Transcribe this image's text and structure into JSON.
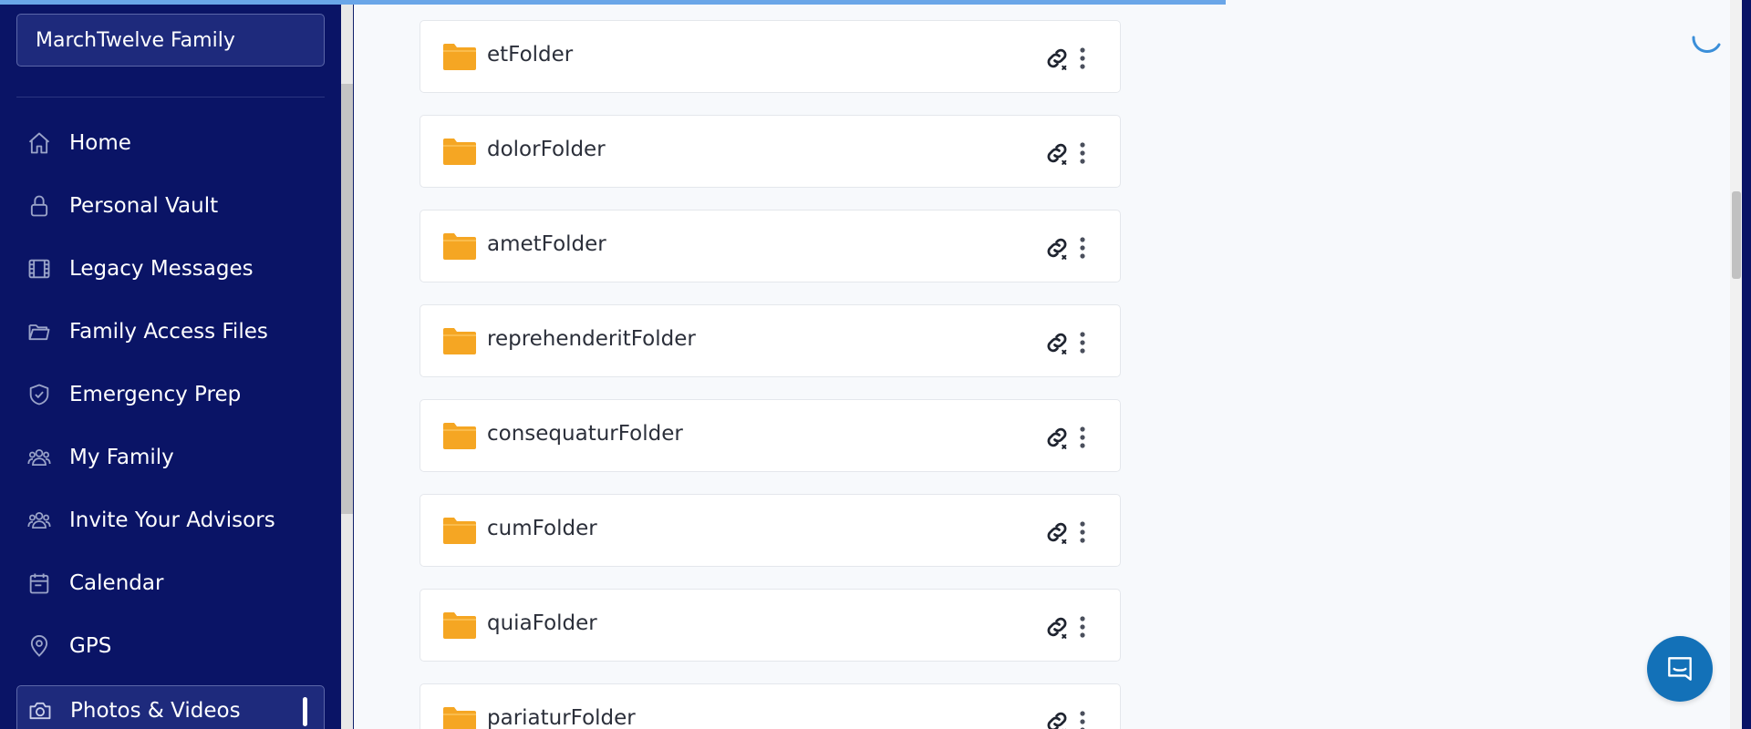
{
  "header": {
    "page_loading_progress": 0.7
  },
  "sidebar": {
    "family_name": "MarchTwelve Family",
    "items": [
      {
        "label": "Home",
        "icon": "home-icon"
      },
      {
        "label": "Personal Vault",
        "icon": "lock-icon"
      },
      {
        "label": "Legacy Messages",
        "icon": "film-icon"
      },
      {
        "label": "Family Access Files",
        "icon": "folder-icon"
      },
      {
        "label": "Emergency Prep",
        "icon": "shield-icon"
      },
      {
        "label": "My Family",
        "icon": "users-icon"
      },
      {
        "label": "Invite Your Advisors",
        "icon": "users-icon"
      },
      {
        "label": "Calendar",
        "icon": "calendar-icon"
      },
      {
        "label": "GPS",
        "icon": "map-pin-icon"
      }
    ],
    "active_item": {
      "label": "Photos & Videos",
      "icon": "camera-icon"
    }
  },
  "main": {
    "folders": [
      {
        "name": "etFolder"
      },
      {
        "name": "dolorFolder"
      },
      {
        "name": "ametFolder"
      },
      {
        "name": "reprehenderitFolder"
      },
      {
        "name": "consequaturFolder"
      },
      {
        "name": "cumFolder"
      },
      {
        "name": "quiaFolder"
      },
      {
        "name": "pariaturFolder"
      }
    ]
  },
  "colors": {
    "sidebar_bg": "#0a1466",
    "folder_color": "#f5a623",
    "accent": "#1371b8",
    "progress": "#6aa6e8"
  }
}
